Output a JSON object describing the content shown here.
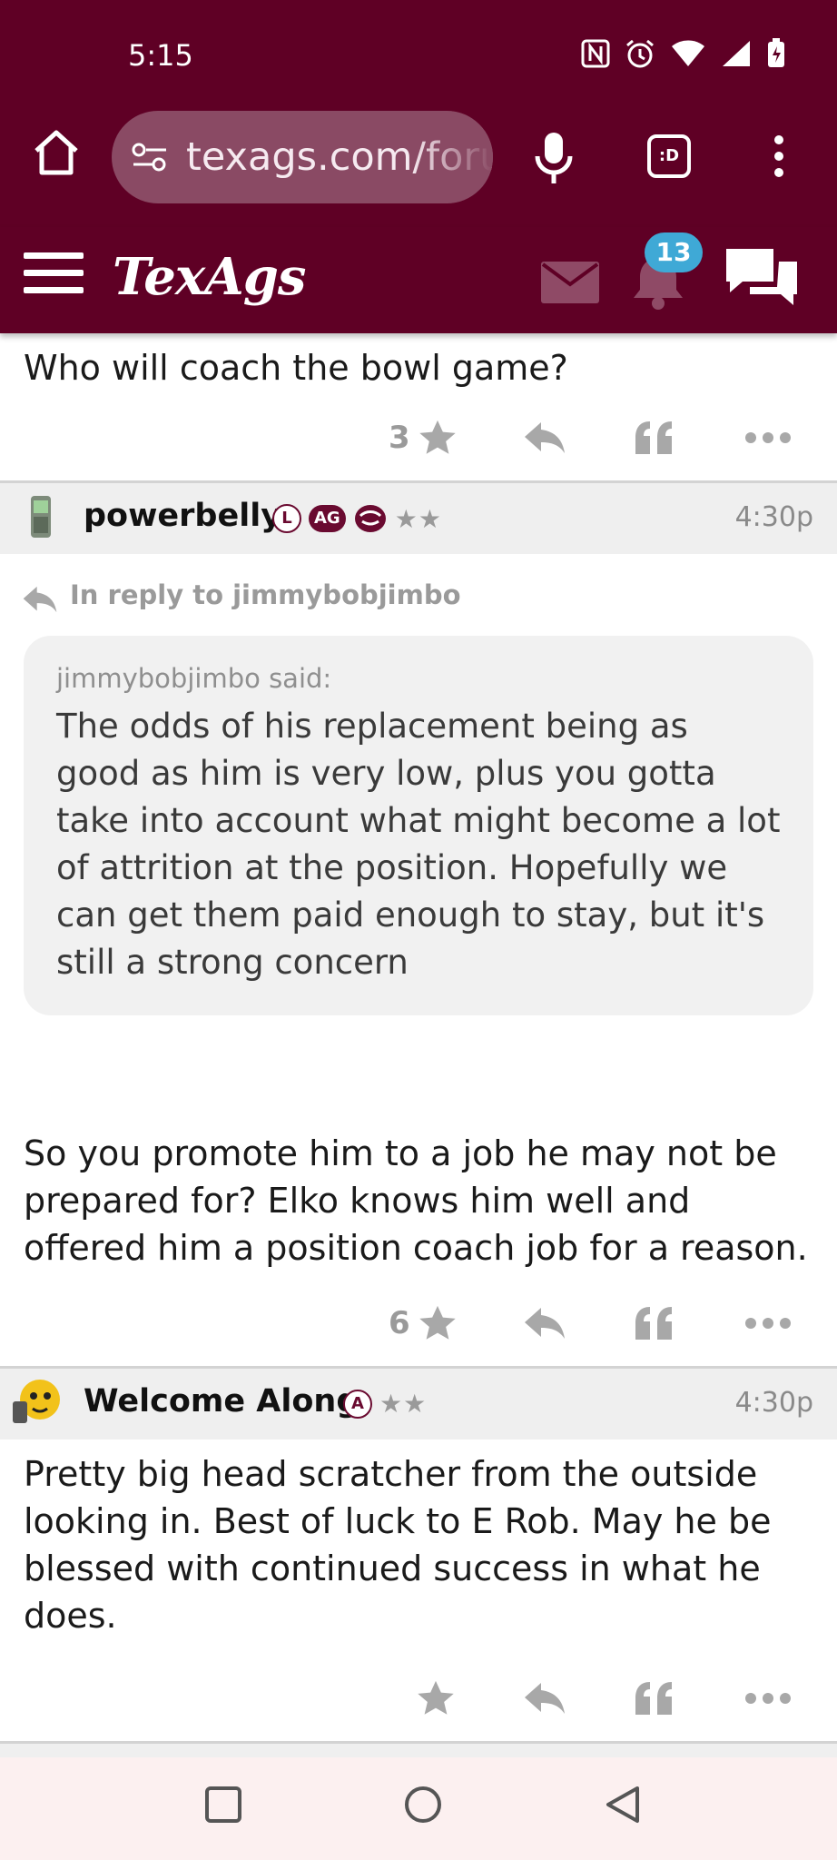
{
  "status_bar": {
    "time": "5:15"
  },
  "browser": {
    "url": "texags.com/forums",
    "tabs_icon_label": ":D"
  },
  "site": {
    "logo": "TexAgs",
    "notification_count": "13"
  },
  "posts": [
    {
      "body": "Who will coach the bowl game?",
      "rating": "3"
    },
    {
      "username": "powerbelly",
      "badges": [
        "L",
        "AG"
      ],
      "stars": "★★",
      "time": "4:30p",
      "in_reply_to": "In reply to jimmybobjimbo",
      "quote_author": "jimmybobjimbo said:",
      "quote_body": "The odds of his replacement being as good as him is very low, plus you gotta take into account what might become a lot of attrition at the position. Hopefully we can get them paid enough to stay, but it's still a strong concern",
      "body": "So you promote him to a job he may not be prepared for? Elko knows him well and offered him a position coach job for a reason.",
      "rating": "6"
    },
    {
      "username": "Welcome Along",
      "badges": [
        "A"
      ],
      "stars": "★★",
      "time": "4:30p",
      "body": "Pretty big head scratcher from the outside looking in. Best of luck to E Rob. May he be blessed with continued success in what he does.",
      "rating": ""
    }
  ],
  "icons": {
    "rate": "star-icon",
    "reply": "reply-arrow-icon",
    "quote": "quote-icon",
    "more": "more-horizontal-icon"
  },
  "colors": {
    "maroon": "#5f0025",
    "badge_blue": "#3fa9d6",
    "muted": "#9a9a9a"
  }
}
